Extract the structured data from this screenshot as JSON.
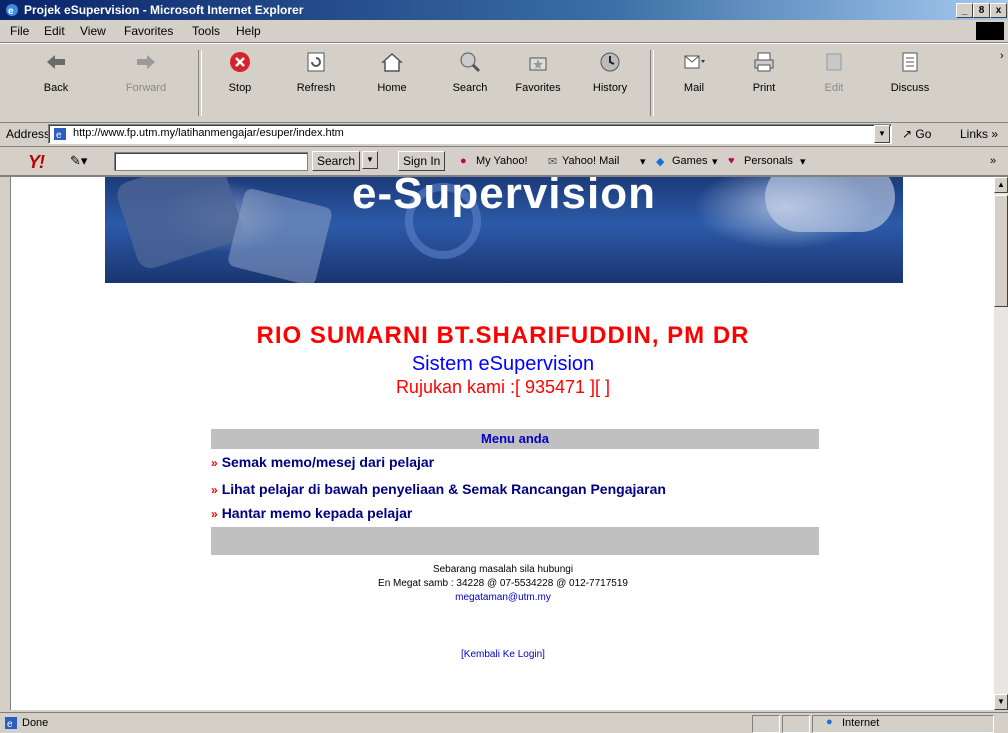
{
  "window": {
    "title": "Projek eSupervision - Microsoft Internet Explorer",
    "caption_buttons": [
      "_",
      "8",
      "x"
    ]
  },
  "menubar": {
    "items": [
      "File",
      "Edit",
      "View",
      "Favorites",
      "Tools",
      "Help"
    ]
  },
  "toolbar": {
    "back": "Back",
    "forward": "Forward",
    "stop": "Stop",
    "refresh": "Refresh",
    "home": "Home",
    "search": "Search",
    "favorites": "Favorites",
    "history": "History",
    "mail": "Mail",
    "print": "Print",
    "edit": "Edit",
    "discuss": "Discuss"
  },
  "address": {
    "label": "Address",
    "url": "http://www.fp.utm.my/latihanmengajar/esuper/index.htm",
    "go": "Go",
    "links": "Links"
  },
  "yahoo": {
    "logo": "Y!",
    "search_button": "Search",
    "sign_in": "Sign In",
    "my_yahoo": "My Yahoo!",
    "yahoo_mail": "Yahoo! Mail",
    "games": "Games",
    "personals": "Personals"
  },
  "page": {
    "banner_title": "e-Supervision",
    "person_name": "RIO SUMARNI BT.SHARIFUDDIN, PM DR",
    "system_name": "Sistem eSupervision",
    "reference": "Rujukan kami :[ 935471 ][  ]",
    "menu_header": "Menu anda",
    "menu_items": [
      "Semak memo/mesej dari pelajar",
      "Lihat pelajar di bawah penyeliaan & Semak Rancangan Pengajaran",
      "Hantar memo kepada pelajar"
    ],
    "bullet": "»",
    "contact_line1": "Sebarang masalah sila hubungi",
    "contact_line2": "En Megat samb : 34228 @ 07-5534228 @ 012-7717519",
    "contact_email": "megataman@utm.my",
    "back_link": "[Kembali Ke Login]"
  },
  "status": {
    "text": "Done",
    "zone": "Internet"
  }
}
